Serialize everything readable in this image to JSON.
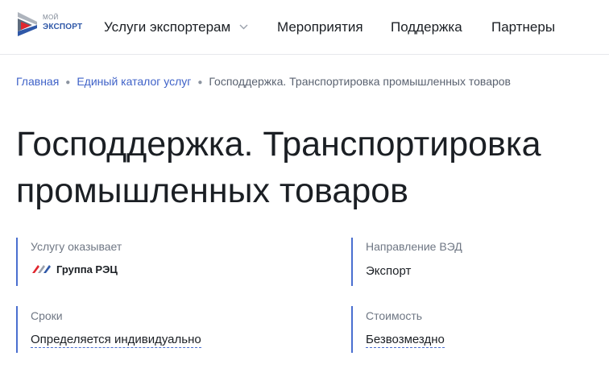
{
  "logo": {
    "line1": "МОЙ",
    "line2": "ЭКСПОРТ"
  },
  "nav": {
    "items": [
      {
        "label": "Услуги экспортерам",
        "has_dropdown": true
      },
      {
        "label": "Мероприятия"
      },
      {
        "label": "Поддержка"
      },
      {
        "label": "Партнеры"
      }
    ]
  },
  "breadcrumb": {
    "items": [
      "Главная",
      "Единый каталог услуг"
    ],
    "current": "Господдержка. Транспортировка промышленных товаров"
  },
  "page": {
    "title_line1": "Господдержка. Транспортировка",
    "title_line2": "промышленных товаров"
  },
  "info": {
    "provider_label": "Услугу оказывает",
    "provider_value": "Группа РЭЦ",
    "direction_label": "Направление ВЭД",
    "direction_value": "Экспорт",
    "terms_label": "Сроки",
    "terms_value": "Определяется индивидуально",
    "cost_label": "Стоимость",
    "cost_value": "Безвозмездно"
  },
  "colors": {
    "accent": "#4a6fd0",
    "link": "#3f62c8",
    "logo_red": "#e0262e",
    "logo_gray": "#9aa1ac"
  }
}
